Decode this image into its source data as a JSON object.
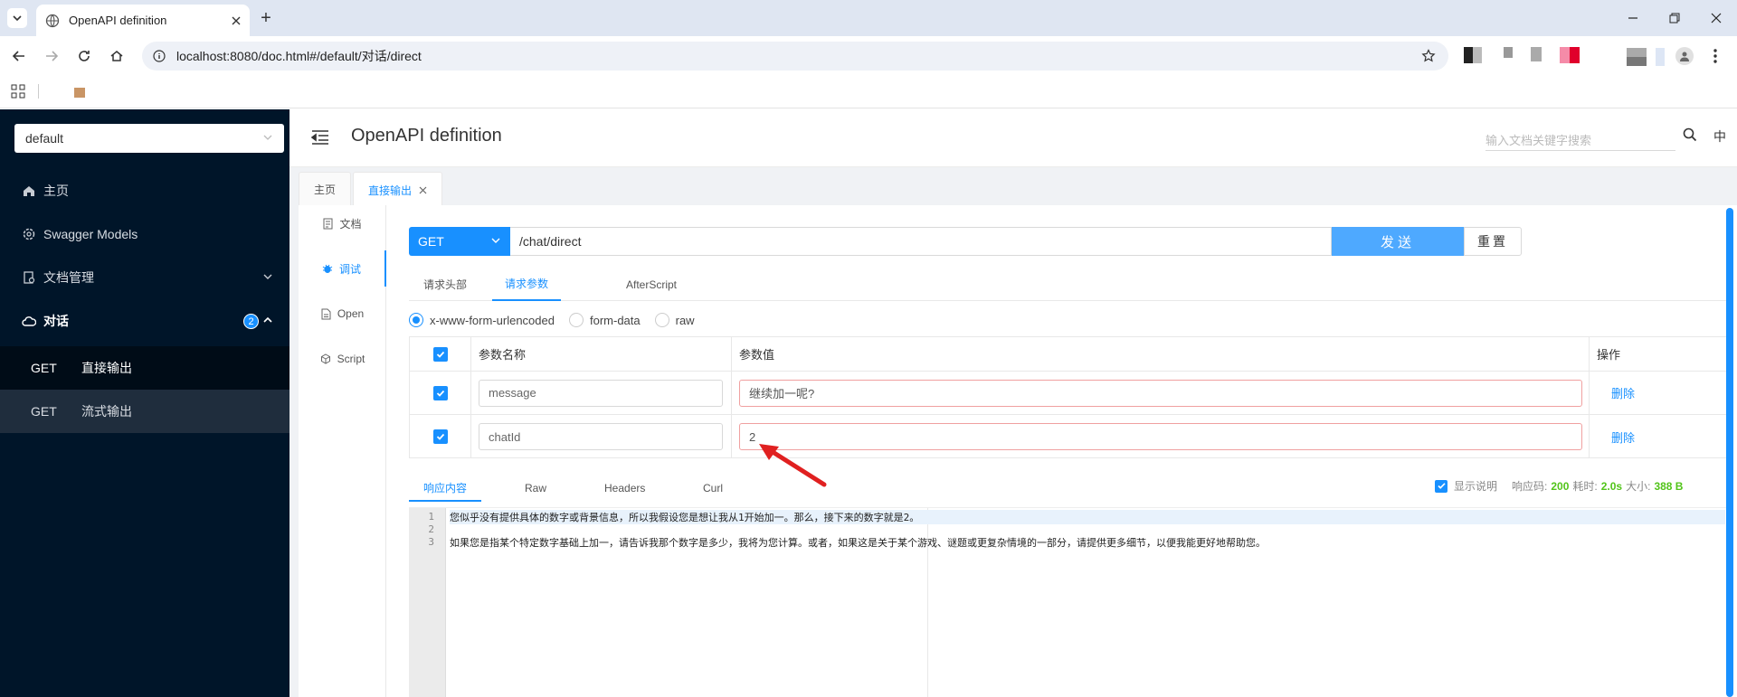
{
  "browser": {
    "tab_title": "OpenAPI definition",
    "url": "localhost:8080/doc.html#/default/对话/direct"
  },
  "sidebar": {
    "group": "default",
    "items": [
      {
        "label": "主页",
        "icon": "home-icon"
      },
      {
        "label": "Swagger Models",
        "icon": "gear-icon"
      },
      {
        "label": "文档管理",
        "icon": "doc-manage-icon"
      },
      {
        "label": "对话",
        "icon": "cloud-icon",
        "badge": "2"
      }
    ],
    "subitems": [
      {
        "method": "GET",
        "label": "直接输出",
        "active": true
      },
      {
        "method": "GET",
        "label": "流式输出",
        "active": false
      }
    ]
  },
  "header": {
    "title": "OpenAPI definition",
    "search_placeholder": "输入文档关键字搜索",
    "lang": "中"
  },
  "doc_tabs": [
    {
      "label": "主页"
    },
    {
      "label": "直接输出",
      "active": true
    }
  ],
  "vmenu": [
    {
      "label": "文档",
      "icon": "document-icon"
    },
    {
      "label": "调试",
      "icon": "bug-icon",
      "active": true
    },
    {
      "label": "Open",
      "icon": "file-icon"
    },
    {
      "label": "Script",
      "icon": "script-icon"
    }
  ],
  "request": {
    "method": "GET",
    "path": "/chat/direct",
    "send_label": "发送",
    "reset_label": "重置"
  },
  "sub_tabs": [
    "请求头部",
    "请求参数",
    "AfterScript"
  ],
  "content_types": [
    "x-www-form-urlencoded",
    "form-data",
    "raw"
  ],
  "params": {
    "headers": {
      "name": "参数名称",
      "value": "参数值",
      "op": "操作"
    },
    "rows": [
      {
        "name": "message",
        "value": "继续加一呢?",
        "delete": "删除"
      },
      {
        "name": "chatId",
        "value": "2",
        "delete": "删除"
      }
    ]
  },
  "response": {
    "tabs": [
      "响应内容",
      "Raw",
      "Headers",
      "Curl"
    ],
    "show_desc": "显示说明",
    "code_label": "响应码:",
    "code": "200",
    "time_label": "耗时:",
    "time": "2.0s",
    "size_label": "大小:",
    "size": "388 B",
    "lines": [
      "您似乎没有提供具体的数字或背景信息，所以我假设您是想让我从1开始加一。那么，接下来的数字就是2。",
      "",
      "如果您是指某个特定数字基础上加一，请告诉我那个数字是多少，我将为您计算。或者，如果这是关于某个游戏、谜题或更复杂情境的一部分，请提供更多细节，以便我能更好地帮助您。"
    ]
  },
  "colors": {
    "accent": "#1890ff",
    "sidebar_bg": "#001529",
    "annotation": "#e02020"
  }
}
